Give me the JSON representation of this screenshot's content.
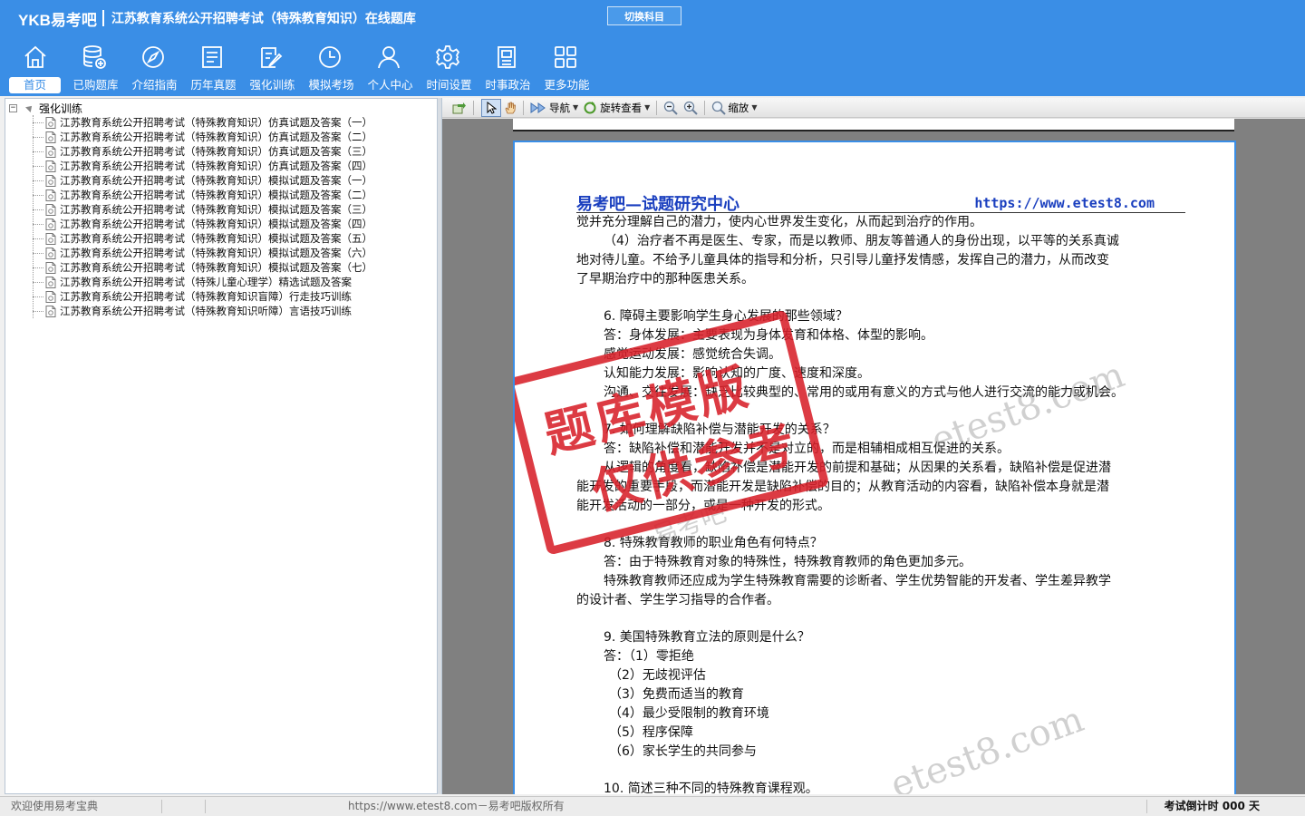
{
  "header": {
    "logo": "YKB易考吧",
    "title": "江苏教育系统公开招聘考试（特殊教育知识）在线题库",
    "switch_subject": "切换科目",
    "nav": [
      {
        "label": "首页",
        "icon": "home-icon"
      },
      {
        "label": "已购题库",
        "icon": "database-icon"
      },
      {
        "label": "介绍指南",
        "icon": "compass-icon"
      },
      {
        "label": "历年真题",
        "icon": "list-icon"
      },
      {
        "label": "强化训练",
        "icon": "edit-icon"
      },
      {
        "label": "模拟考场",
        "icon": "clock-icon"
      },
      {
        "label": "个人中心",
        "icon": "user-icon"
      },
      {
        "label": "时间设置",
        "icon": "gear-icon"
      },
      {
        "label": "时事政治",
        "icon": "news-icon"
      },
      {
        "label": "更多功能",
        "icon": "grid-icon"
      }
    ]
  },
  "tree": {
    "root_label": "强化训练",
    "items": [
      "江苏教育系统公开招聘考试（特殊教育知识）仿真试题及答案（一）",
      "江苏教育系统公开招聘考试（特殊教育知识）仿真试题及答案（二）",
      "江苏教育系统公开招聘考试（特殊教育知识）仿真试题及答案（三）",
      "江苏教育系统公开招聘考试（特殊教育知识）仿真试题及答案（四）",
      "江苏教育系统公开招聘考试（特殊教育知识）模拟试题及答案（一）",
      "江苏教育系统公开招聘考试（特殊教育知识）模拟试题及答案（二）",
      "江苏教育系统公开招聘考试（特殊教育知识）模拟试题及答案（三）",
      "江苏教育系统公开招聘考试（特殊教育知识）模拟试题及答案（四）",
      "江苏教育系统公开招聘考试（特殊教育知识）模拟试题及答案（五）",
      "江苏教育系统公开招聘考试（特殊教育知识）模拟试题及答案（六）",
      "江苏教育系统公开招聘考试（特殊教育知识）模拟试题及答案（七）",
      "江苏教育系统公开招聘考试（特殊儿童心理学）精选试题及答案",
      "江苏教育系统公开招聘考试（特殊教育知识盲障）行走技巧训练",
      "江苏教育系统公开招聘考试（特殊教育知识听障）言语技巧训练"
    ]
  },
  "toolbar": {
    "nav_label": "导航",
    "rotate_label": "旋转查看",
    "zoom_label": "缩放"
  },
  "document": {
    "header_left": "易考吧—试题研究中心",
    "header_right": "https://www.etest8.com",
    "lines": [
      "觉并充分理解自己的潜力，使内心世界发生变化，从而起到治疗的作用。",
      "（4）治疗者不再是医生、专家，而是以教师、朋友等普通人的身份出现，以平等的关系真诚",
      "地对待儿童。不给予儿童具体的指导和分析，只引导儿童抒发情感，发挥自己的潜力，从而改变",
      "了早期治疗中的那种医患关系。",
      "6. 障碍主要影响学生身心发展的那些领域？",
      "答：身体发展：主要表现为身体发育和体格、体型的影响。",
      "感觉运动发展：感觉统合失调。",
      "认知能力发展：影响认知的广度、速度和深度。",
      "沟通、交往发展：缺乏比较典型的、常用的或用有意义的方式与他人进行交流的能力或机会。",
      "7. 如何理解缺陷补偿与潜能开发的关系？",
      "答：缺陷补偿和潜能开发并不是对立的，而是相辅相成相互促进的关系。",
      "从逻辑的角度看，缺陷补偿是潜能开发的前提和基础；从因果的关系看，缺陷补偿是促进潜",
      "能开发的重要手段，而潜能开发是缺陷补偿的目的；从教育活动的内容看，缺陷补偿本身就是潜",
      "能开发活动的一部分，或是一种开发的形式。",
      "8. 特殊教育教师的职业角色有何特点？",
      "答：由于特殊教育对象的特殊性，特殊教育教师的角色更加多元。",
      "特殊教育教师还应成为学生特殊教育需要的诊断者、学生优势智能的开发者、学生差异教学",
      "的设计者、学生学习指导的合作者。",
      "9. 美国特殊教育立法的原则是什么？",
      "答：（1）零拒绝",
      "（2）无歧视评估",
      "（3）免费而适当的教育",
      "（4）最少受限制的教育环境",
      "（5）程序保障",
      "（6）家长学生的共同参与",
      "10. 简述三种不同的特殊教育课程观。"
    ],
    "stamp_line1": "题库模版",
    "stamp_line2": "仅供参考",
    "watermark1": "etest8.com",
    "watermark2": "etest8.com",
    "watermark3": "易考吧"
  },
  "status": {
    "welcome": "欢迎使用易考宝典",
    "copyright": "https://www.etest8.com－易考吧版权所有",
    "countdown": "考试倒计时 000 天"
  },
  "colors": {
    "header_bg": "#3a8ee6",
    "doc_header": "#1a3fbf",
    "stamp": "#d8202a"
  }
}
